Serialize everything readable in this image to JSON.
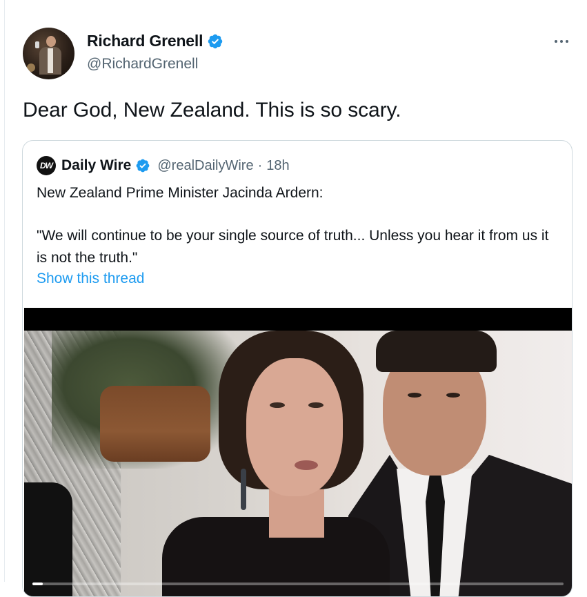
{
  "author": {
    "display_name": "Richard Grenell",
    "handle": "@RichardGrenell",
    "verified": true
  },
  "tweet": {
    "text": "Dear God, New Zealand. This is so scary."
  },
  "quoted_tweet": {
    "logo_text": "DW",
    "display_name": "Daily Wire",
    "handle": "@realDailyWire",
    "separator": "·",
    "time": "18h",
    "line1": "New Zealand Prime Minister Jacinda Ardern:",
    "line2": "\"We will continue to be your single source of truth... Unless you hear it from us it is not the truth.\"",
    "show_thread": "Show this thread"
  },
  "video": {
    "progress_fraction": 0.02
  },
  "colors": {
    "verified_blue": "#1d9bf0",
    "link_blue": "#1d9bf0",
    "secondary_text": "#536471"
  },
  "icons": {
    "verified": "verified-badge-icon",
    "more": "more-options-icon"
  }
}
